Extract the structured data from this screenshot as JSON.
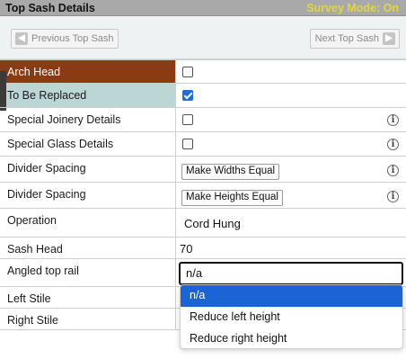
{
  "header": {
    "title": "Top Sash Details",
    "survey_mode": "Survey Mode: On"
  },
  "nav": {
    "prev_label": "Previous Top Sash",
    "next_label": "Next Top Sash",
    "prev_icon": "arrow-left-icon",
    "next_icon": "arrow-right-icon"
  },
  "rows": {
    "arch_head": {
      "label": "Arch Head",
      "checked": false
    },
    "to_be_replaced": {
      "label": "To Be Replaced",
      "checked": true
    },
    "special_joinery": {
      "label": "Special Joinery Details",
      "checked": false
    },
    "special_glass": {
      "label": "Special Glass Details",
      "checked": false
    },
    "divider_width": {
      "label": "Divider Spacing",
      "button": "Make Widths Equal"
    },
    "divider_height": {
      "label": "Divider Spacing",
      "button": "Make Heights Equal"
    },
    "operation": {
      "label": "Operation",
      "value": "Cord Hung"
    },
    "sash_head": {
      "label": "Sash Head",
      "value": "70"
    },
    "angled_top_rail": {
      "label": "Angled top rail",
      "value": "n/a"
    },
    "left_stile": {
      "label": "Left Stile"
    },
    "right_stile": {
      "label": "Right Stile"
    }
  },
  "dropdown": {
    "options": [
      "n/a",
      "Reduce left height",
      "Reduce right height"
    ],
    "selected": "n/a"
  },
  "colors": {
    "arch_head_bg": "#8a3b14",
    "to_be_replaced_bg": "#bcd6d5",
    "survey_mode_text": "#e0d642",
    "selected_option_bg": "#1a64d6"
  },
  "info_icon_glyph": "i"
}
